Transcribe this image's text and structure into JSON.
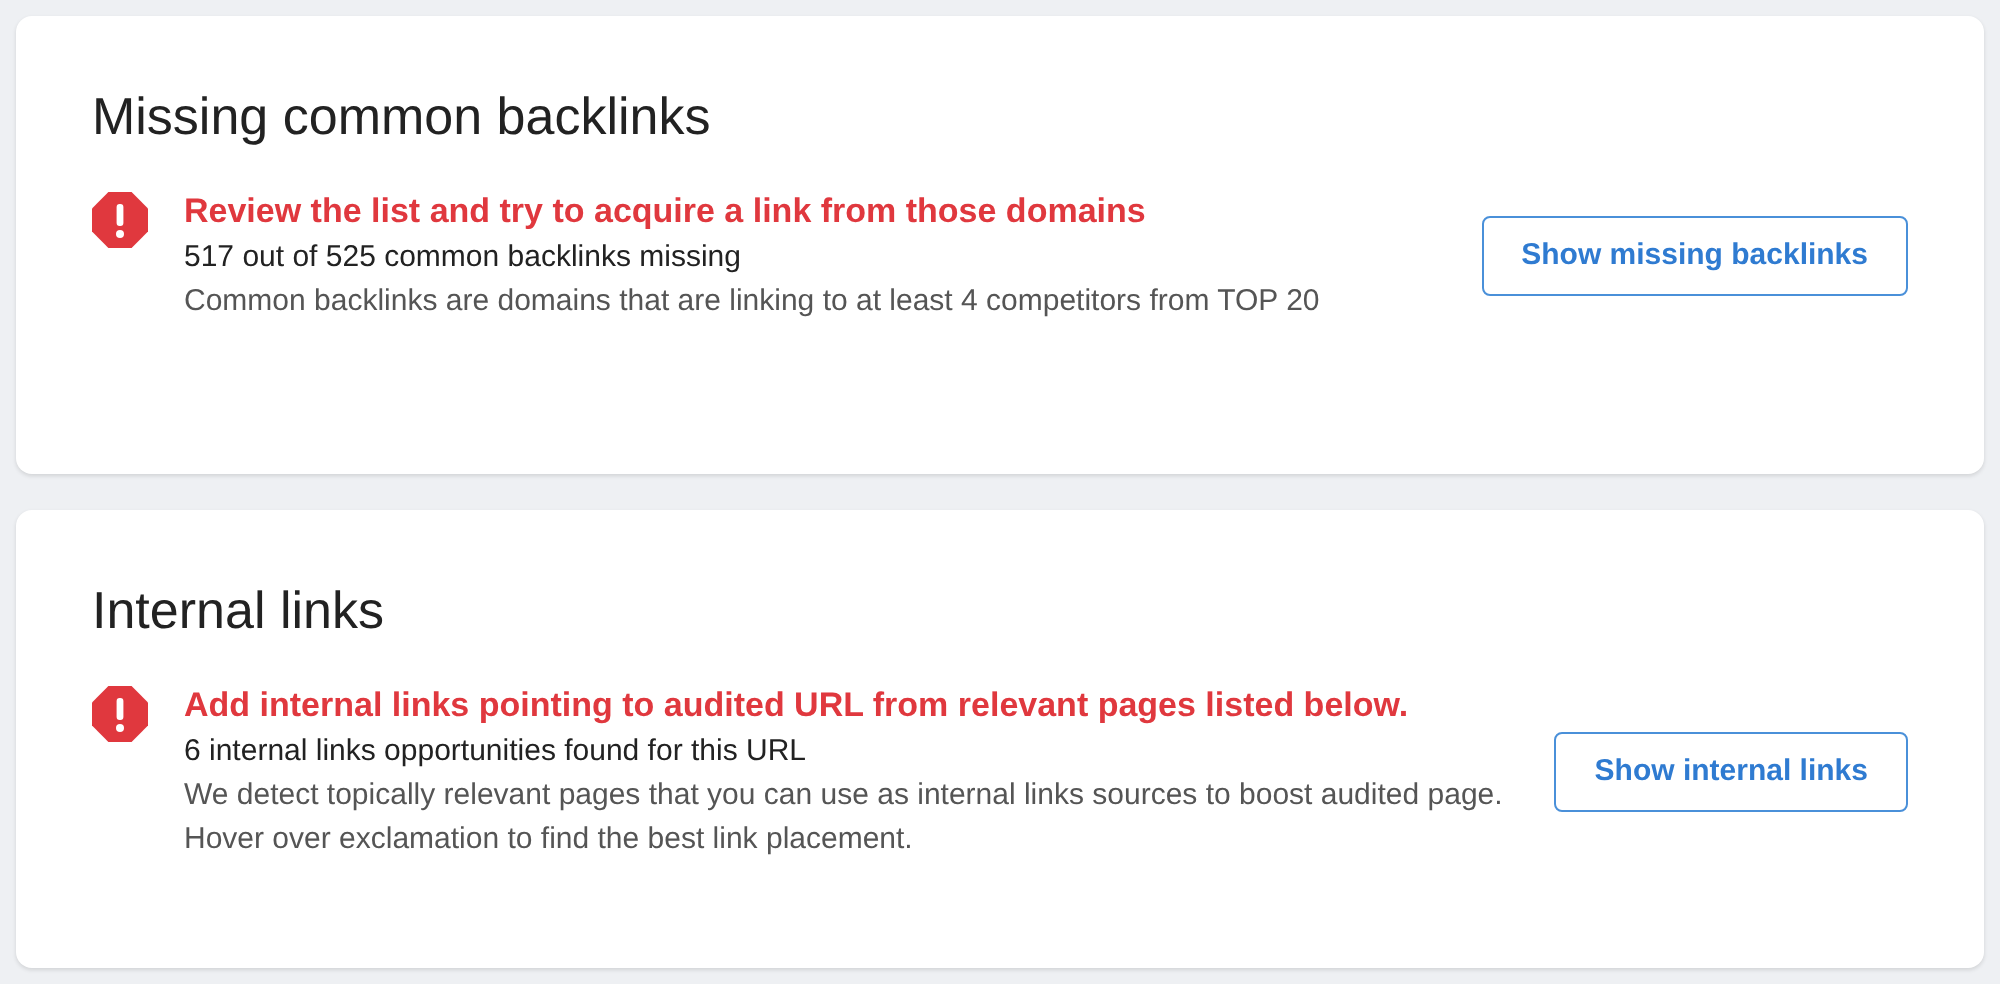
{
  "cards": [
    {
      "title": "Missing common backlinks",
      "headline": "Review the list and try to acquire a link from those domains",
      "summary": "517 out of 525 common backlinks missing",
      "description": "Common backlinks are domains that are linking to at least 4 competitors from TOP 20",
      "button": "Show missing backlinks"
    },
    {
      "title": "Internal links",
      "headline": "Add internal links pointing to audited URL from relevant pages listed below.",
      "summary": "6 internal links opportunities found for this URL",
      "description": "We detect topically relevant pages that you can use as internal links sources to boost audited page. Hover over exclamation to find the best link placement.",
      "button": "Show internal links"
    }
  ]
}
